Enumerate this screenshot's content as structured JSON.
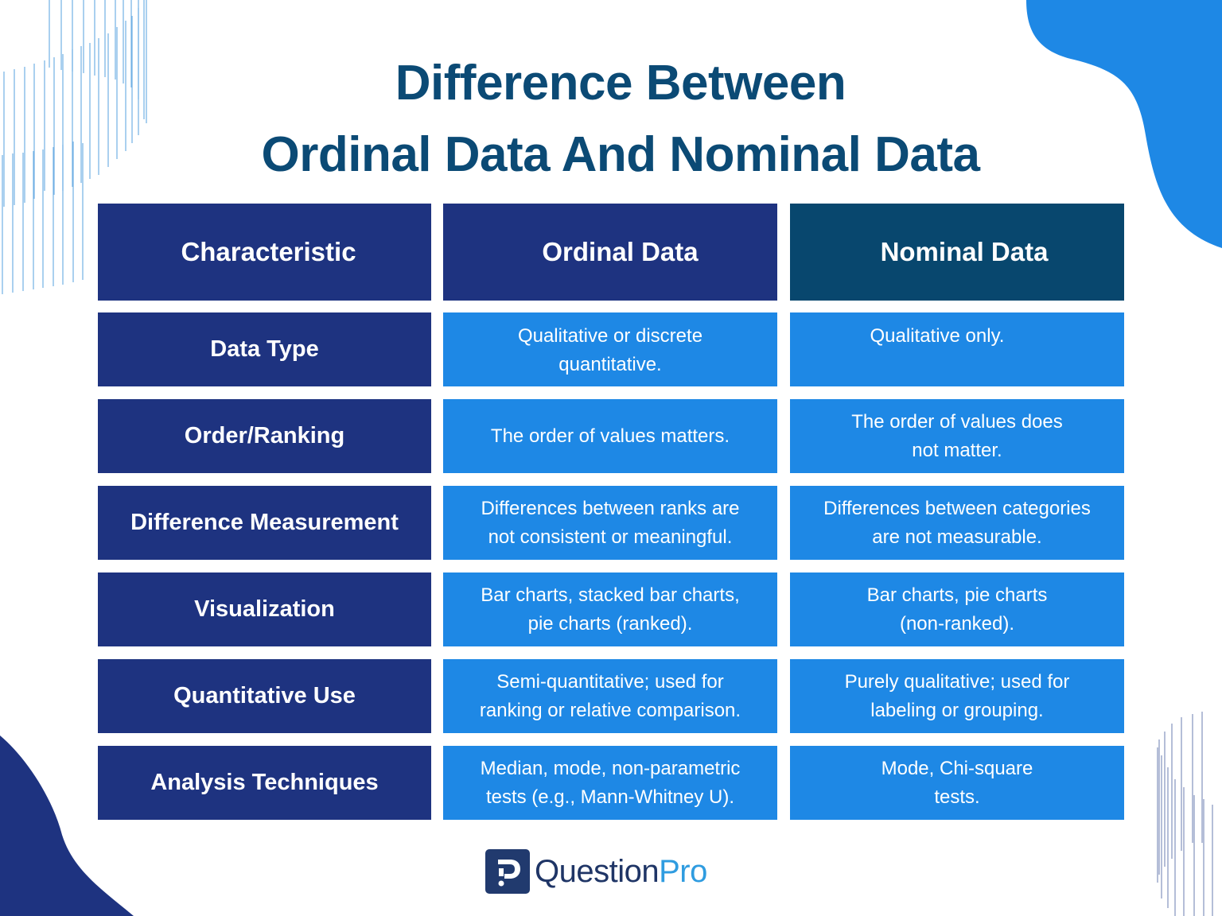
{
  "title": {
    "line1": "Difference Between",
    "line2": "Ordinal Data And Nominal Data"
  },
  "colors": {
    "title": "#0b4a75",
    "header_dark": "#1e3380",
    "header_nominal": "#08476e",
    "value_cell": "#1e88e5",
    "blob_top_right": "#1e88e5",
    "blob_bottom_left": "#1e3380"
  },
  "table": {
    "headers": [
      "Characteristic",
      "Ordinal Data",
      "Nominal Data"
    ],
    "rows": [
      {
        "characteristic": "Data Type",
        "ordinal": "Qualitative or discrete\nquantitative.",
        "nominal": "Qualitative only."
      },
      {
        "characteristic": "Order/Ranking",
        "ordinal": "The order of values matters.",
        "nominal": "The order of values does\nnot matter."
      },
      {
        "characteristic": "Difference Measurement",
        "ordinal": "Differences between ranks are\nnot consistent or meaningful.",
        "nominal": "Differences between categories\nare not measurable."
      },
      {
        "characteristic": "Visualization",
        "ordinal": "Bar charts, stacked bar charts,\npie charts (ranked).",
        "nominal": "Bar charts, pie charts\n(non-ranked)."
      },
      {
        "characteristic": "Quantitative Use",
        "ordinal": "Semi-quantitative; used for\nranking or relative comparison.",
        "nominal": "Purely qualitative; used for\nlabeling or grouping."
      },
      {
        "characteristic": "Analysis Techniques",
        "ordinal": "Median, mode, non-parametric\ntests (e.g., Mann-Whitney U).",
        "nominal": "Mode, Chi-square\ntests."
      }
    ]
  },
  "logo": {
    "brand_main": "Question",
    "brand_accent": "Pro",
    "icon": "questionpro-logo-icon"
  }
}
